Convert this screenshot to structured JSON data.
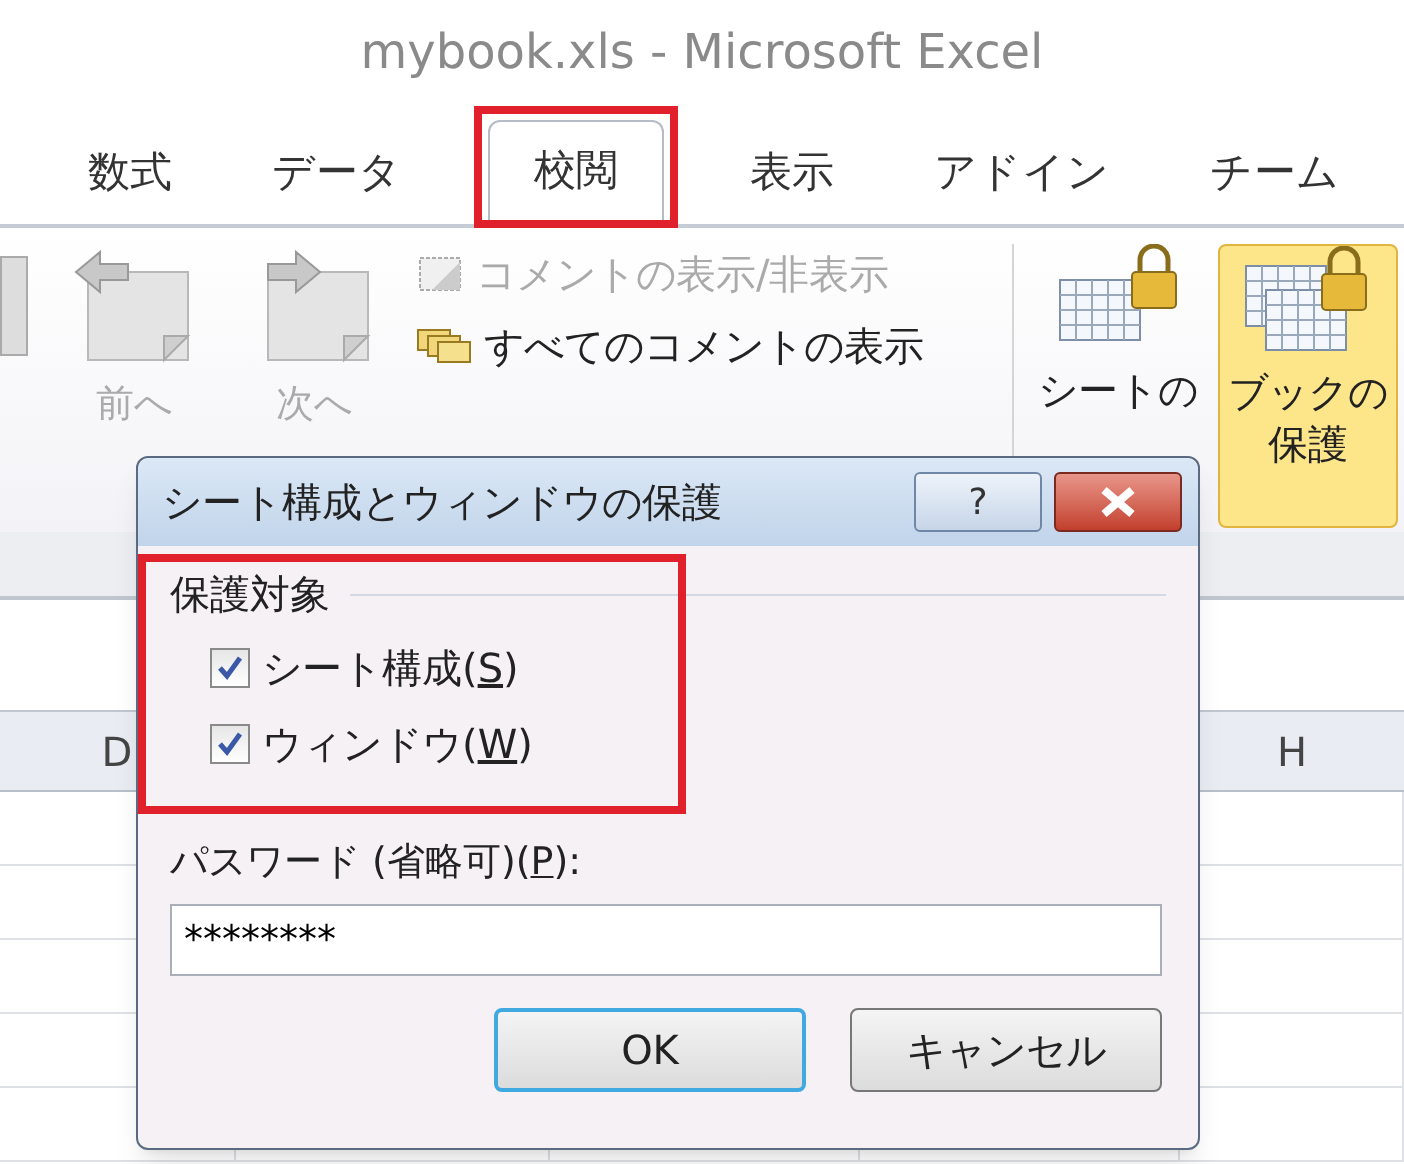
{
  "window": {
    "title": "mybook.xls - Microsoft Excel"
  },
  "tabs": [
    {
      "label": "数式",
      "selected": false,
      "highlighted": false
    },
    {
      "label": "データ",
      "selected": false,
      "highlighted": false
    },
    {
      "label": "校閲",
      "selected": true,
      "highlighted": true
    },
    {
      "label": "表示",
      "selected": false,
      "highlighted": false
    },
    {
      "label": "アドイン",
      "selected": false,
      "highlighted": false
    },
    {
      "label": "チーム",
      "selected": false,
      "highlighted": false
    }
  ],
  "ribbon": {
    "nav_buttons": [
      {
        "kind": "previous",
        "label": "前へ"
      },
      {
        "kind": "next",
        "label": "次へ"
      }
    ],
    "comment_items": [
      {
        "kind": "toggle",
        "label": "コメントの表示/非表示",
        "disabled": true
      },
      {
        "kind": "all",
        "label": "すべてのコメントの表示",
        "disabled": false
      }
    ],
    "protect_buttons": [
      {
        "kind": "sheet",
        "lines": [
          "シートの"
        ],
        "selected": false
      },
      {
        "kind": "book",
        "lines": [
          "ブックの",
          "保護"
        ],
        "selected": true
      }
    ]
  },
  "columns": [
    {
      "label": "D"
    },
    {
      "label": "H"
    }
  ],
  "dialog": {
    "title": "シート構成とウィンドウの保護",
    "help": "?",
    "group": {
      "label": "保護対象",
      "highlighted": true,
      "options": [
        {
          "before": "シート構成(",
          "accelerator": "S",
          "after": ")",
          "checked": true
        },
        {
          "before": "ウィンドウ(",
          "accelerator": "W",
          "after": ")",
          "checked": true
        }
      ]
    },
    "password": {
      "before": "パスワード (省略可)(",
      "accelerator": "P",
      "after": "):",
      "value": "********"
    },
    "buttons": [
      {
        "label": "OK",
        "default": true
      },
      {
        "label": "キャンセル",
        "default": false
      }
    ]
  }
}
